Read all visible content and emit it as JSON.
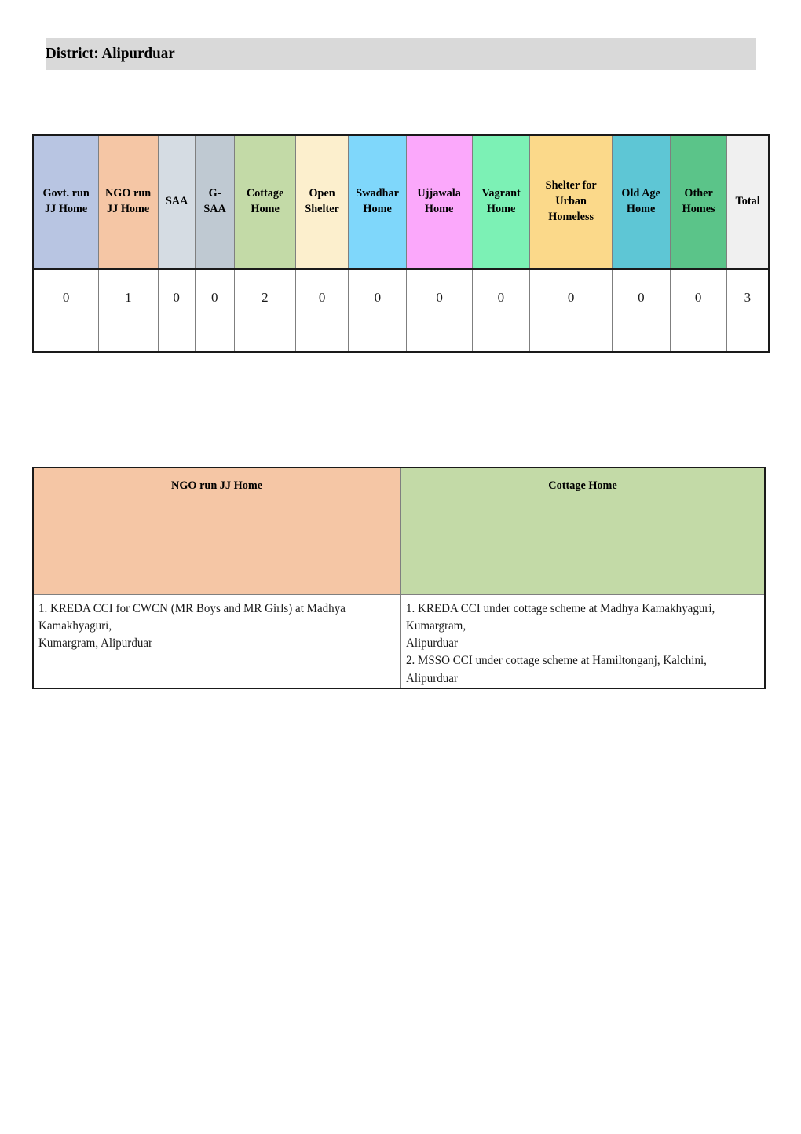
{
  "page": {
    "title": "District: Alipurduar",
    "title_band_color": "#d9d9d9"
  },
  "summary_table": {
    "columns": [
      {
        "label": "Govt. run JJ Home",
        "color": "#b8c5e2",
        "value": "0"
      },
      {
        "label": "NGO run JJ Home",
        "color": "#f5c6a5",
        "value": "1"
      },
      {
        "label": "SAA",
        "color": "#d5dce3",
        "value": "0"
      },
      {
        "label": "G-SAA",
        "color": "#bfc9d2",
        "value": "0"
      },
      {
        "label": "Cottage Home",
        "color": "#c3daa7",
        "value": "2"
      },
      {
        "label": "Open Shelter",
        "color": "#fcefcd",
        "value": "0"
      },
      {
        "label": "Swadhar Home",
        "color": "#7fd7fb",
        "value": "0"
      },
      {
        "label": "Ujjawala Home",
        "color": "#fba8fb",
        "value": "0"
      },
      {
        "label": "Vagrant Home",
        "color": "#7cf1b5",
        "value": "0"
      },
      {
        "label": "Shelter for Urban Homeless",
        "color": "#fbd98a",
        "value": "0"
      },
      {
        "label": "Old Age Home",
        "color": "#5ec6d5",
        "value": "0"
      },
      {
        "label": "Other Homes",
        "color": "#5bc489",
        "value": "0"
      },
      {
        "label": "Total",
        "color": "#f0f0f0",
        "value": "3"
      }
    ]
  },
  "details_table": {
    "headers": [
      {
        "label": "NGO run JJ Home",
        "color": "#f5c6a5"
      },
      {
        "label": "Cottage Home",
        "color": "#c3daa7"
      }
    ],
    "cells": [
      {
        "entries": [
          "1. KREDA CCI for CWCN (MR Boys and MR Girls) at Madhya Kamakhyaguri,",
          "Kumargram, Alipurduar"
        ]
      },
      {
        "entries": [
          "1. KREDA CCI under cottage scheme at Madhya Kamakhyaguri, Kumargram,",
          "Alipurduar",
          "2. MSSO CCI under cottage scheme at Hamiltonganj, Kalchini, Alipurduar"
        ]
      }
    ]
  }
}
